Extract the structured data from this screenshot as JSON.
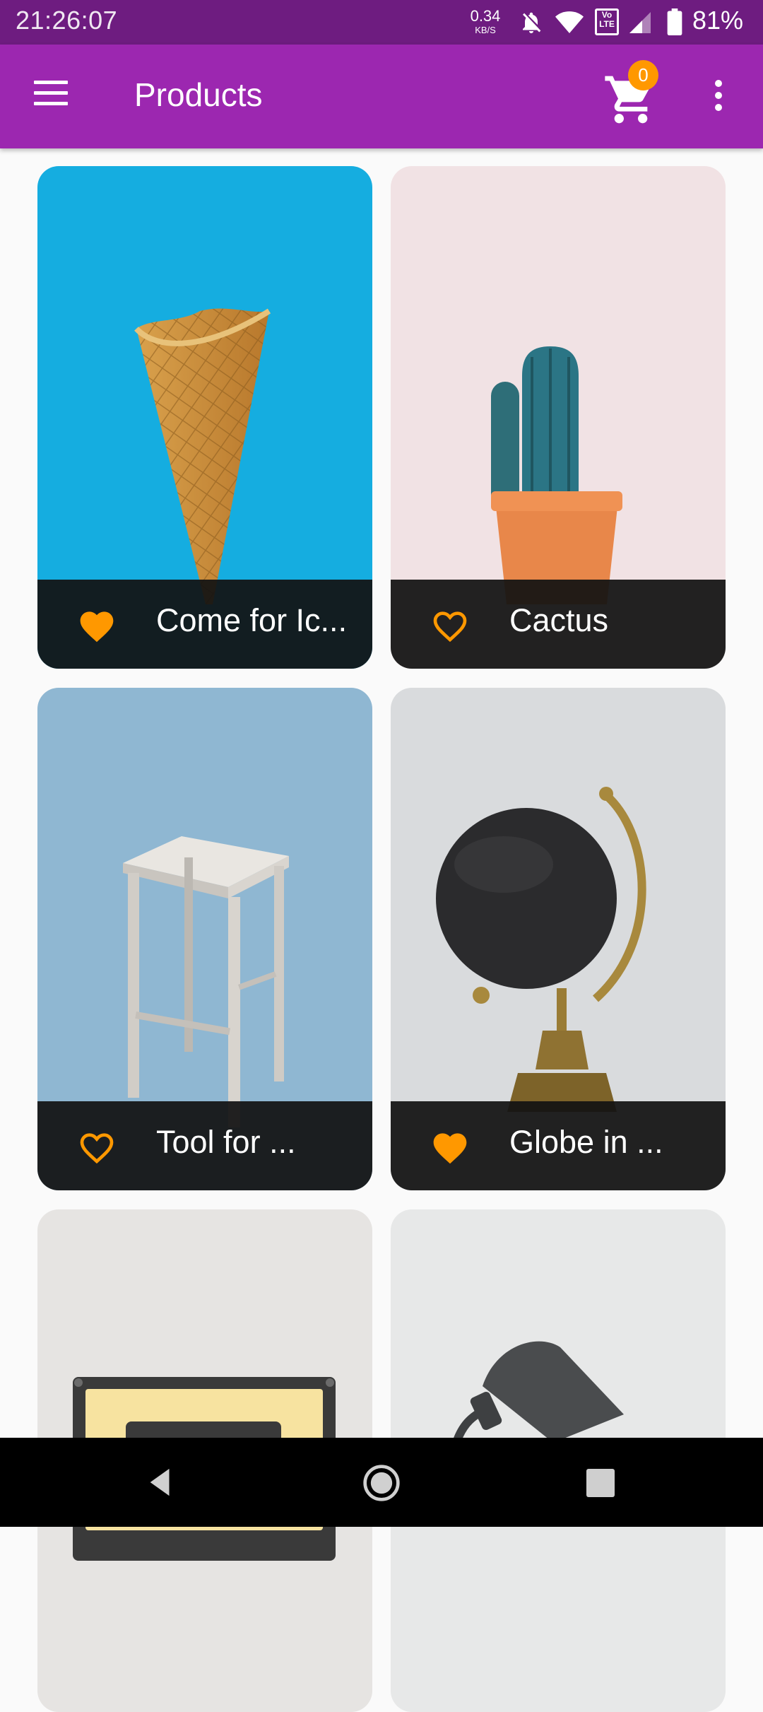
{
  "status_bar": {
    "time": "21:26:07",
    "speed_value": "0.34",
    "speed_unit": "KB/S",
    "lte_badge_top": "Vo",
    "lte_badge_bottom": "LTE",
    "battery": "81%"
  },
  "app_bar": {
    "title": "Products",
    "cart_count": "0",
    "icons": [
      "menu-icon",
      "cart-icon",
      "more-vert-icon"
    ]
  },
  "colors": {
    "app_bar": "#9c27b0",
    "status_bar": "#6e1c80",
    "accent": "#ff9800",
    "caption_bg": "#121212"
  },
  "products": [
    {
      "name": "Come for Ic...",
      "favorite": true
    },
    {
      "name": "Cactus",
      "favorite": false
    },
    {
      "name": "Tool for ...",
      "favorite": false
    },
    {
      "name": "Globe in ...",
      "favorite": true
    },
    {
      "name": "",
      "favorite": null
    },
    {
      "name": "",
      "favorite": null
    }
  ],
  "nav_bar": {
    "icons": [
      "back-icon",
      "home-icon",
      "recents-icon"
    ]
  }
}
